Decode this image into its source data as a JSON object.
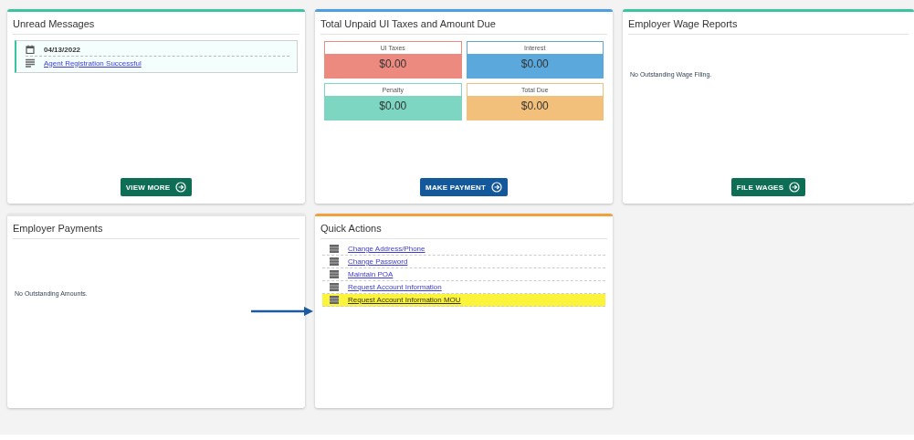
{
  "cards": [
    {
      "kind": "messages",
      "title": "Unread Messages",
      "color": "#3cc4a2",
      "messages": [
        {
          "date": "04/13/2022",
          "subject": "Agent Registration Successful"
        }
      ],
      "button": {
        "label": "VIEW MORE",
        "color": "#0e6e55"
      }
    },
    {
      "kind": "totals",
      "title": "Total Unpaid UI Taxes and Amount Due",
      "color": "#4c9fe0",
      "tiles": [
        {
          "label": "UI Taxes",
          "value": "$0.00",
          "color": "#ec8a80"
        },
        {
          "label": "Interest",
          "value": "$0.00",
          "color": "#5aa8dc"
        },
        {
          "label": "Penalty",
          "value": "$0.00",
          "color": "#7dd6c2"
        },
        {
          "label": "Total Due",
          "value": "$0.00",
          "color": "#f2c07a"
        }
      ],
      "button": {
        "label": "MAKE PAYMENT",
        "color": "#12589a"
      }
    },
    {
      "kind": "note",
      "title": "Employer Wage Reports",
      "color": "#3cc4a2",
      "note": "No Outstanding Wage Filing.",
      "button": {
        "label": "FILE WAGES",
        "color": "#0e6e55"
      }
    },
    {
      "kind": "note",
      "title": "Employer Payments",
      "color": "#e6e6e6",
      "note": "No Outstanding Amounts."
    },
    {
      "kind": "actions",
      "title": "Quick Actions",
      "color": "#f0a03c",
      "actions": [
        {
          "label": "Change Address/Phone",
          "highlighted": false
        },
        {
          "label": "Change Password",
          "highlighted": false
        },
        {
          "label": "Maintain POA",
          "highlighted": false
        },
        {
          "label": "Request Account Information",
          "highlighted": false
        },
        {
          "label": "Request Account Information MOU",
          "highlighted": true
        }
      ]
    }
  ]
}
